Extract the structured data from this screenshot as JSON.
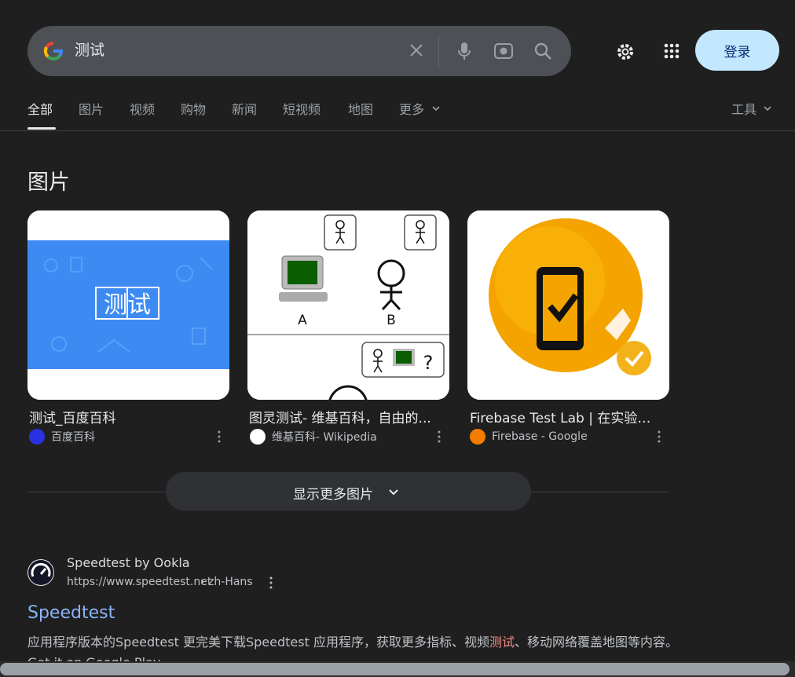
{
  "search": {
    "query": "测试",
    "login_label": "登录"
  },
  "tabs": [
    {
      "label": "全部",
      "active": true
    },
    {
      "label": "图片"
    },
    {
      "label": "视频"
    },
    {
      "label": "购物"
    },
    {
      "label": "新闻"
    },
    {
      "label": "短视频"
    },
    {
      "label": "地图"
    },
    {
      "label": "更多"
    }
  ],
  "tools_label": "工具",
  "images": {
    "title": "图片",
    "cards": [
      {
        "caption": "测试_百度百科",
        "source": "百度百科",
        "tile_text": "测试"
      },
      {
        "caption": "图灵测试- 维基百科，自由的...",
        "source": "维基百科- Wikipedia",
        "label_a": "A",
        "label_b": "B",
        "question": "?"
      },
      {
        "caption": "Firebase Test Lab | 在实验室...",
        "source": "Firebase - Google"
      }
    ],
    "show_more_label": "显示更多图片"
  },
  "result": {
    "site_name": "Speedtest by Ookla",
    "url": "https://www.speedtest.net",
    "url_crumb": "› zh-Hans",
    "title": "Speedtest",
    "snippet_before": "应用程序版本的Speedtest 更完美下载Speedtest 应用程序，获取更多指标、视频",
    "snippet_highlight": "测试",
    "snippet_after": "、移动网络覆盖地图等内容。Get it on Google Play"
  },
  "colors": {
    "background": "#1f1f1f",
    "link": "#8ab4f8",
    "login_bg": "#c2e7ff",
    "highlight": "#f28b82"
  }
}
